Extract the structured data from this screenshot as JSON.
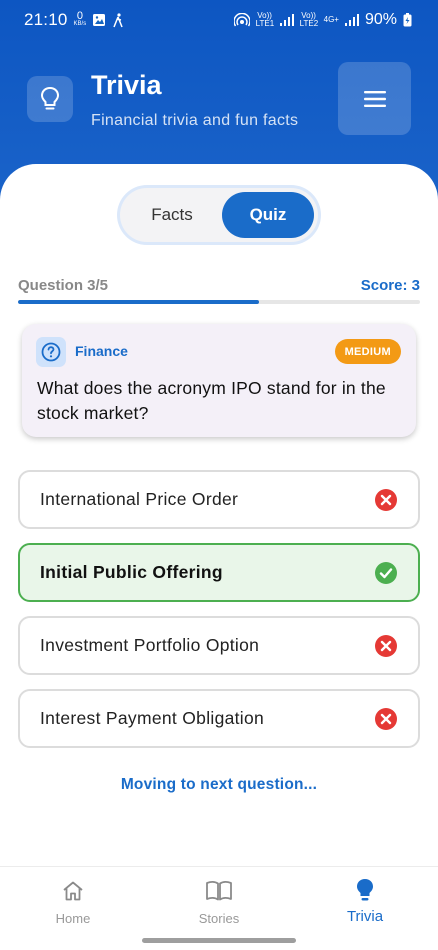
{
  "status_bar": {
    "time": "21:10",
    "net_speed_value": "0",
    "net_speed_unit": "KB/s",
    "sim1_label": "Vo)) LTE1",
    "sim2_label": "Vo)) LTE2",
    "sim2_net": "4G+",
    "battery": "90%"
  },
  "header": {
    "title": "Trivia",
    "subtitle": "Financial trivia and fun facts"
  },
  "tabs": [
    {
      "label": "Facts",
      "active": false
    },
    {
      "label": "Quiz",
      "active": true
    }
  ],
  "progress": {
    "question_label": "Question 3/5",
    "score_label": "Score: 3",
    "fraction": 0.6
  },
  "question": {
    "category": "Finance",
    "difficulty": "MEDIUM",
    "text": "What does the acronym IPO stand for in the stock market?"
  },
  "options": [
    {
      "label": "International Price Order",
      "correct": false
    },
    {
      "label": "Initial Public Offering",
      "correct": true
    },
    {
      "label": "Investment Portfolio Option",
      "correct": false
    },
    {
      "label": "Interest Payment Obligation",
      "correct": false
    }
  ],
  "next_message": "Moving to next question...",
  "bottom_nav": [
    {
      "label": "Home",
      "icon": "home-icon",
      "active": false
    },
    {
      "label": "Stories",
      "icon": "book-icon",
      "active": false
    },
    {
      "label": "Trivia",
      "icon": "lightbulb-icon",
      "active": true
    }
  ],
  "colors": {
    "primary": "#1a6cc9",
    "header_bg": "#0d56c2",
    "correct": "#4caf50",
    "wrong": "#e53935",
    "badge": "#f39a15"
  }
}
